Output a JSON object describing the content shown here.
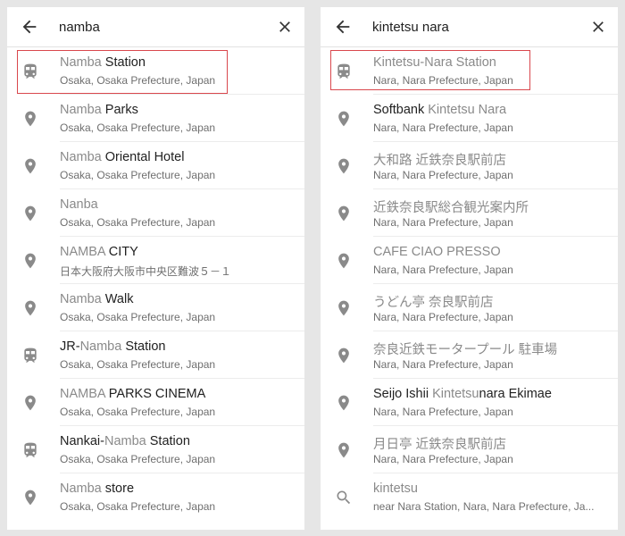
{
  "colors": {
    "accent": "#d9474d",
    "icon": "#8a8a8a",
    "text": "#212121",
    "muted": "#8a8a8a"
  },
  "left_panel": {
    "query": "namba",
    "results": [
      {
        "icon": "train-icon",
        "title": [
          {
            "t": "Namba ",
            "b": false
          },
          {
            "t": "Station",
            "b": true
          }
        ],
        "sub": "Osaka, Osaka Prefecture, Japan"
      },
      {
        "icon": "place-pin-icon",
        "title": [
          {
            "t": "Namba ",
            "b": false
          },
          {
            "t": "Parks",
            "b": true
          }
        ],
        "sub": "Osaka, Osaka Prefecture, Japan"
      },
      {
        "icon": "place-pin-icon",
        "title": [
          {
            "t": "Namba ",
            "b": false
          },
          {
            "t": "Oriental Hotel",
            "b": true
          }
        ],
        "sub": "Osaka, Osaka Prefecture, Japan"
      },
      {
        "icon": "place-pin-icon",
        "title": [
          {
            "t": "Nanba",
            "b": false
          }
        ],
        "sub": "Osaka, Osaka Prefecture, Japan"
      },
      {
        "icon": "place-pin-icon",
        "title": [
          {
            "t": "NAMBA ",
            "b": false
          },
          {
            "t": "CITY",
            "b": true
          }
        ],
        "sub": "日本大阪府大阪市中央区難波５－１"
      },
      {
        "icon": "place-pin-icon",
        "title": [
          {
            "t": "Namba ",
            "b": false
          },
          {
            "t": "Walk",
            "b": true
          }
        ],
        "sub": "Osaka, Osaka Prefecture, Japan"
      },
      {
        "icon": "train-icon",
        "title": [
          {
            "t": "JR-",
            "b": true
          },
          {
            "t": "Namba ",
            "b": false
          },
          {
            "t": "Station",
            "b": true
          }
        ],
        "sub": "Osaka, Osaka Prefecture, Japan"
      },
      {
        "icon": "place-pin-icon",
        "title": [
          {
            "t": "NAMBA ",
            "b": false
          },
          {
            "t": "PARKS CINEMA",
            "b": true
          }
        ],
        "sub": "Osaka, Osaka Prefecture, Japan"
      },
      {
        "icon": "train-icon",
        "title": [
          {
            "t": "Nankai-",
            "b": true
          },
          {
            "t": "Namba ",
            "b": false
          },
          {
            "t": "Station",
            "b": true
          }
        ],
        "sub": "Osaka, Osaka Prefecture, Japan"
      },
      {
        "icon": "place-pin-icon",
        "title": [
          {
            "t": "Namba ",
            "b": false
          },
          {
            "t": "store",
            "b": true
          }
        ],
        "sub": "Osaka, Osaka Prefecture, Japan"
      }
    ]
  },
  "right_panel": {
    "query": "kintetsu nara",
    "results": [
      {
        "icon": "train-icon",
        "title": [
          {
            "t": "Kintetsu-Nara Station",
            "b": false
          }
        ],
        "sub": "Nara, Nara Prefecture, Japan"
      },
      {
        "icon": "place-pin-icon",
        "title": [
          {
            "t": "Softbank ",
            "b": true
          },
          {
            "t": "Kintetsu Nara",
            "b": false
          }
        ],
        "sub": "Nara, Nara Prefecture, Japan"
      },
      {
        "icon": "place-pin-icon",
        "title": [
          {
            "t": "大和路 近鉄奈良駅前店",
            "b": false
          }
        ],
        "sub": "Nara, Nara Prefecture, Japan"
      },
      {
        "icon": "place-pin-icon",
        "title": [
          {
            "t": "近鉄奈良駅総合観光案内所",
            "b": false
          }
        ],
        "sub": "Nara, Nara Prefecture, Japan"
      },
      {
        "icon": "place-pin-icon",
        "title": [
          {
            "t": "CAFE CIAO PRESSO",
            "b": false
          }
        ],
        "sub": "Nara, Nara Prefecture, Japan"
      },
      {
        "icon": "place-pin-icon",
        "title": [
          {
            "t": "うどん亭 奈良駅前店",
            "b": false
          }
        ],
        "sub": "Nara, Nara Prefecture, Japan"
      },
      {
        "icon": "place-pin-icon",
        "title": [
          {
            "t": "奈良近鉄モータープール 駐車場",
            "b": false
          }
        ],
        "sub": "Nara, Nara Prefecture, Japan"
      },
      {
        "icon": "place-pin-icon",
        "title": [
          {
            "t": "Seijo Ishii ",
            "b": true
          },
          {
            "t": "Kintetsu",
            "b": false
          },
          {
            "t": "nara ",
            "b": true
          },
          {
            "t": "Ekimae",
            "b": true
          }
        ],
        "sub": "Nara, Nara Prefecture, Japan"
      },
      {
        "icon": "place-pin-icon",
        "title": [
          {
            "t": "月日亭 近鉄奈良駅前店",
            "b": false
          }
        ],
        "sub": "Nara, Nara Prefecture, Japan"
      },
      {
        "icon": "search-icon",
        "title": [
          {
            "t": "kintetsu",
            "b": false
          }
        ],
        "sub": "near Nara Station, Nara, Nara Prefecture, Ja..."
      }
    ]
  }
}
